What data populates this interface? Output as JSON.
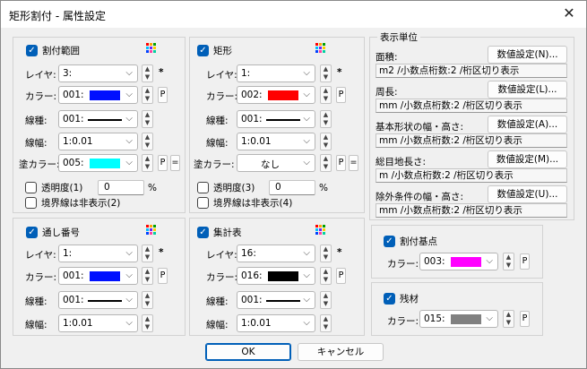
{
  "window": {
    "title": "矩形割付 - 属性設定"
  },
  "g1": {
    "header": "割付範囲",
    "layer_label": "レイヤ:",
    "layer_value": "3:",
    "color_label": "カラー:",
    "color_value": "001:",
    "color_swatch": "#0010ff",
    "ltype_label": "線種:",
    "ltype_value": "001:",
    "lwidth_label": "線幅:",
    "lwidth_value": "1:0.01",
    "fill_label": "塗カラー:",
    "fill_value": "005:",
    "fill_swatch": "#00ffff",
    "opacity_label": "透明度(1)",
    "opacity_value": "0",
    "percent": "%",
    "border_label": "境界線は非表示(2)",
    "star": "*",
    "p": "P",
    "eq": "="
  },
  "g2": {
    "header": "矩形",
    "layer_label": "レイヤ:",
    "layer_value": "1:",
    "color_label": "カラー:",
    "color_value": "002:",
    "color_swatch": "#ff0000",
    "ltype_label": "線種:",
    "ltype_value": "001:",
    "lwidth_label": "線幅:",
    "lwidth_value": "1:0.01",
    "fill_label": "塗カラー:",
    "fill_value": "なし",
    "opacity_label": "透明度(3)",
    "opacity_value": "0",
    "percent": "%",
    "border_label": "境界線は非表示(4)",
    "star": "*",
    "p": "P",
    "eq": "="
  },
  "g3": {
    "header": "通し番号",
    "layer_label": "レイヤ:",
    "layer_value": "1:",
    "color_label": "カラー:",
    "color_value": "001:",
    "color_swatch": "#0010ff",
    "ltype_label": "線種:",
    "ltype_value": "001:",
    "lwidth_label": "線幅:",
    "lwidth_value": "1:0.01",
    "star": "*",
    "p": "P"
  },
  "g4": {
    "header": "集計表",
    "layer_label": "レイヤ:",
    "layer_value": "16:",
    "color_label": "カラー:",
    "color_value": "016:",
    "color_swatch": "#000000",
    "ltype_label": "線種:",
    "ltype_value": "001:",
    "lwidth_label": "線幅:",
    "lwidth_value": "1:0.01",
    "star": "*",
    "p": "P"
  },
  "units": {
    "legend": "表示単位",
    "rows": [
      {
        "label": "面積:",
        "button": "数値設定(N)...",
        "value": "m2 /小数点桁数:2 /桁区切り表示"
      },
      {
        "label": "周長:",
        "button": "数値設定(L)...",
        "value": "mm /小数点桁数:2 /桁区切り表示"
      },
      {
        "label": "基本形状の幅・高さ:",
        "button": "数値設定(A)...",
        "value": "mm /小数点桁数:2 /桁区切り表示"
      },
      {
        "label": "総目地長さ:",
        "button": "数値設定(M)...",
        "value": "m /小数点桁数:2 /桁区切り表示"
      },
      {
        "label": "除外条件の幅・高さ:",
        "button": "数値設定(U)...",
        "value": "mm /小数点桁数:2 /桁区切り表示"
      }
    ]
  },
  "g5": {
    "header": "割付基点",
    "color_label": "カラー:",
    "color_value": "003:",
    "color_swatch": "#ff00ff",
    "p": "P"
  },
  "g6": {
    "header": "残材",
    "color_label": "カラー:",
    "color_value": "015:",
    "color_swatch": "#808080",
    "p": "P"
  },
  "footer": {
    "ok": "OK",
    "cancel": "キャンセル"
  },
  "icons": {
    "check": "✓",
    "arrow": "⌵",
    "spin_up": "▲",
    "spin_down": "▼",
    "close": "✕"
  }
}
